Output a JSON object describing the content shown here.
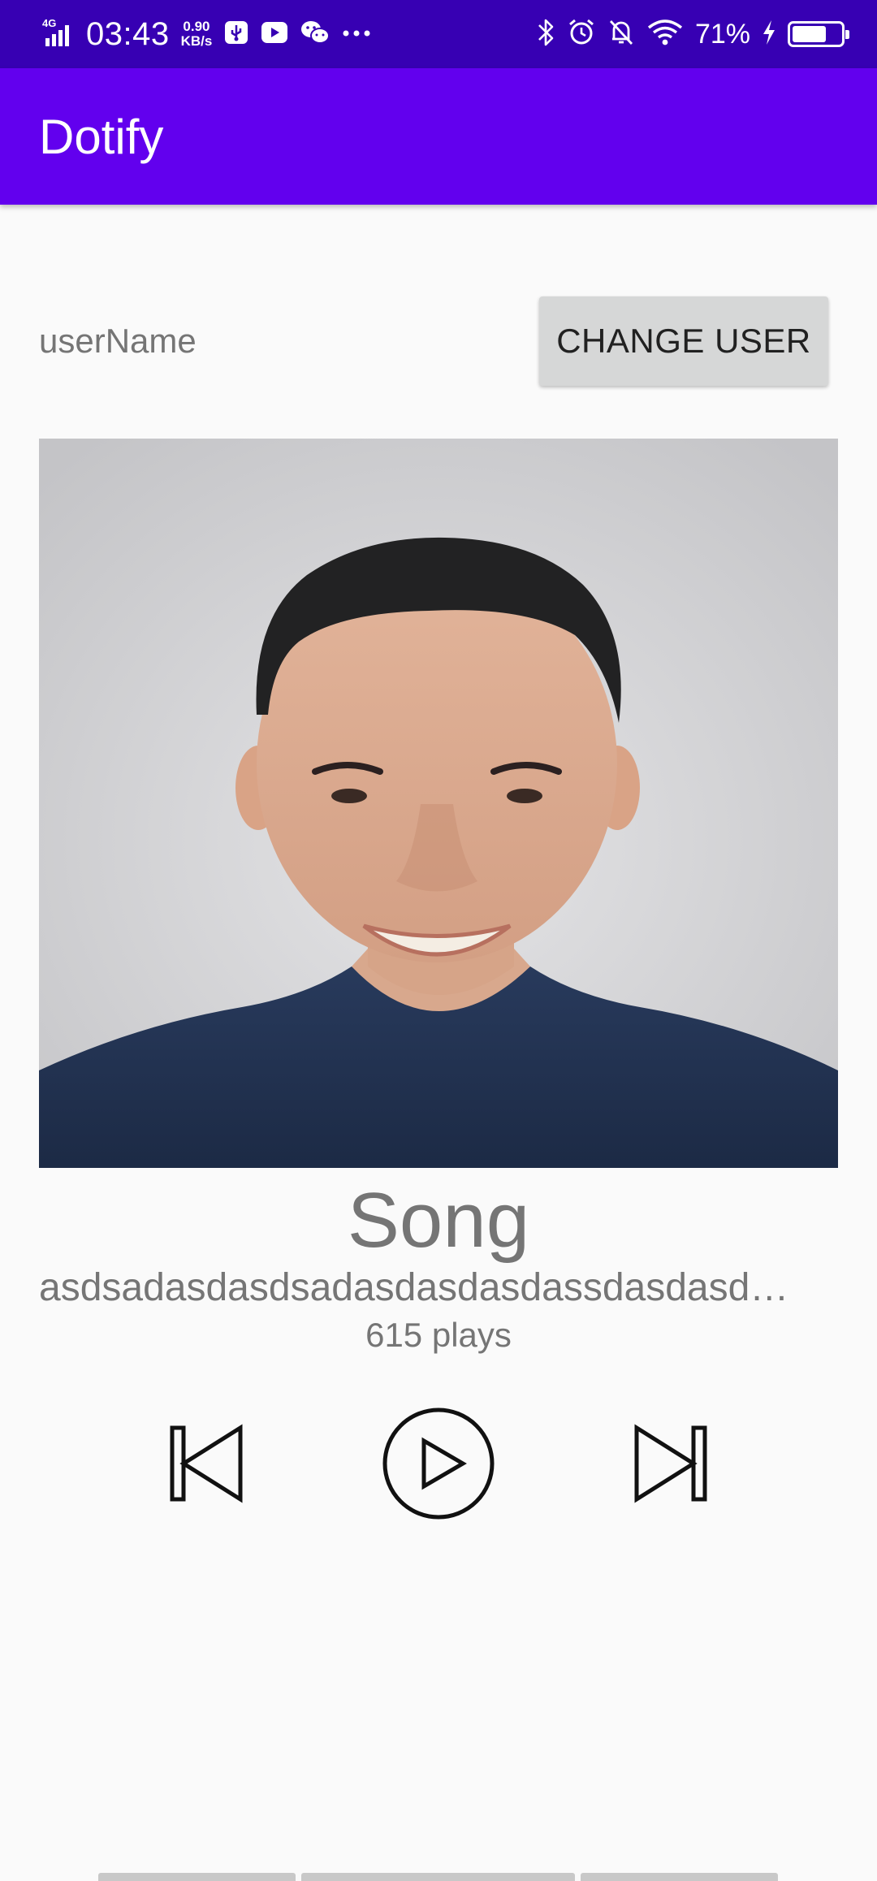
{
  "status_bar": {
    "network": "4G",
    "time": "03:43",
    "speed_value": "0.90",
    "speed_unit": "KB/s",
    "battery": "71%",
    "battery_level": 0.71,
    "left_icons": [
      "signal-icon",
      "usb-icon",
      "youtube-icon",
      "wechat-icon",
      "more-icon"
    ],
    "right_icons": [
      "bluetooth-icon",
      "alarm-icon",
      "mute-icon",
      "wifi-icon",
      "charging-icon",
      "battery-icon"
    ]
  },
  "app_bar": {
    "title": "Dotify"
  },
  "user": {
    "name": "userName",
    "change_button": "CHANGE USER"
  },
  "song": {
    "title": "Song",
    "artist": "asdsadasdasdsadasdasdasdassdasdasd…",
    "plays": "615 plays"
  },
  "controls": [
    "previous-icon",
    "play-icon",
    "next-icon"
  ],
  "colors": {
    "status_bar": "#3700b3",
    "app_bar": "#6200ee",
    "background": "#fafafa",
    "button": "#d6d7d7",
    "text_secondary": "#757575"
  }
}
